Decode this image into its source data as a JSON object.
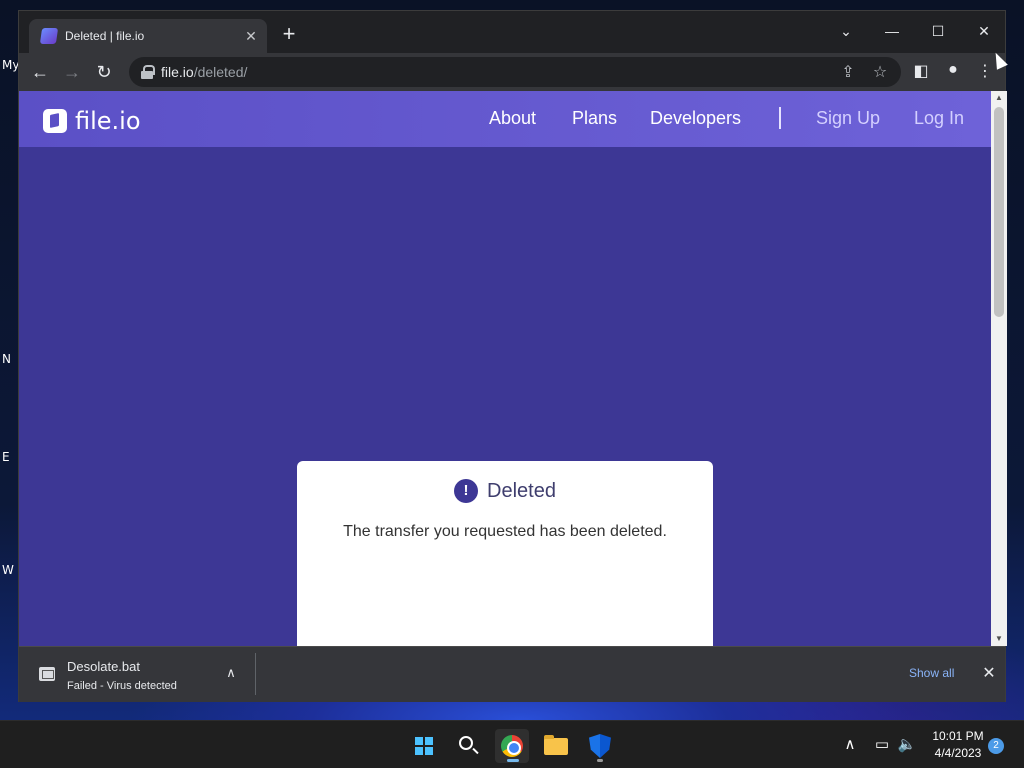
{
  "desktop": {
    "labels": [
      "My",
      "N",
      "E",
      "W"
    ]
  },
  "browser": {
    "tab": {
      "title": "Deleted | file.io"
    },
    "new_tab_glyph": "+",
    "window_controls": {
      "minimize": "—",
      "maximize": "☐",
      "close": "✕",
      "tab_search": "⌄"
    },
    "address": {
      "host": "file.io",
      "path": "/deleted/"
    },
    "icons": [
      "back-arrow-icon",
      "forward-arrow-icon",
      "reload-icon",
      "lock-icon",
      "share-icon",
      "star-icon",
      "side-panel-icon",
      "profile-icon",
      "kebab-menu-icon"
    ]
  },
  "site": {
    "logo_text": "file.io",
    "nav": {
      "about": "About",
      "plans": "Plans",
      "developers": "Developers",
      "sign_up": "Sign Up",
      "log_in": "Log In"
    },
    "colors": {
      "header": "#5b50c6",
      "background": "#3d3795",
      "card": "#ffffff"
    }
  },
  "card": {
    "alert_glyph": "!",
    "title": "Deleted",
    "message": "The transfer you requested has been deleted."
  },
  "download": {
    "file_name": "Desolate.bat",
    "status": "Failed - Virus detected",
    "show_all": "Show all",
    "close_glyph": "✕",
    "chevron_glyph": "∧"
  },
  "taskbar": {
    "apps": [
      "start-icon",
      "search-icon",
      "chrome-icon",
      "file-explorer-icon",
      "security-icon"
    ],
    "tray": {
      "chevron": "∧"
    },
    "clock": {
      "time": "10:01 PM",
      "date": "4/4/2023"
    },
    "notification_count": "2"
  }
}
